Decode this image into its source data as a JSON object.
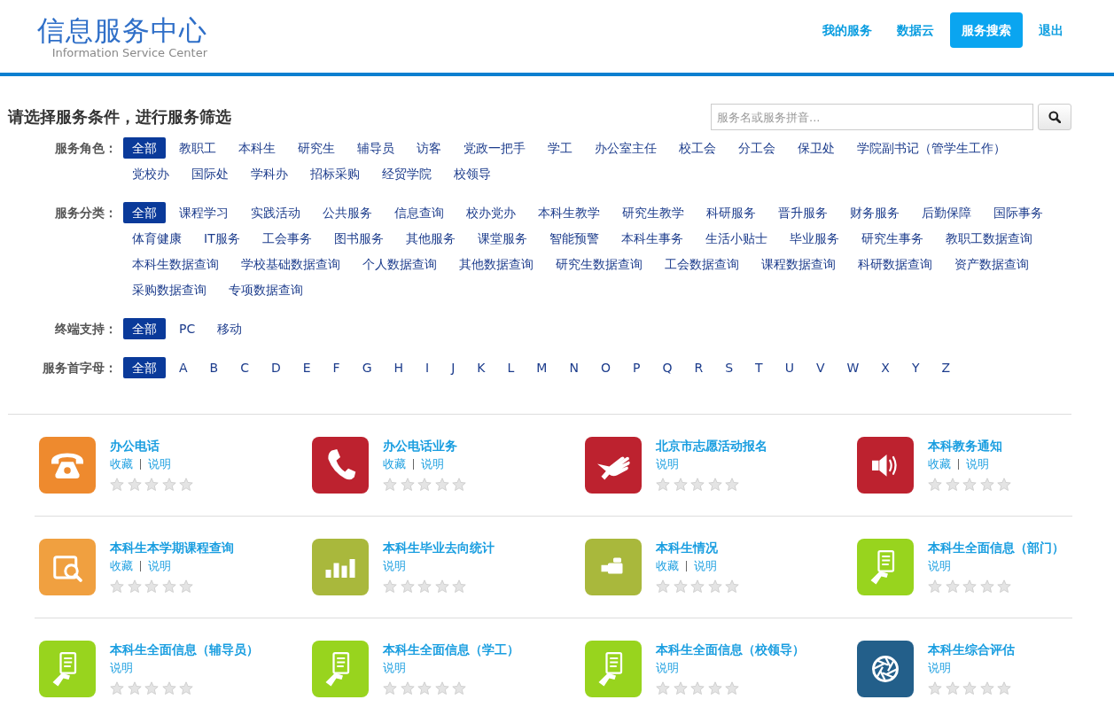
{
  "header": {
    "logo_title": "信息服务中心",
    "logo_subtitle": "Information Service Center",
    "nav": [
      {
        "label": "我的服务",
        "selected": false
      },
      {
        "label": "数据云",
        "selected": false
      },
      {
        "label": "服务搜索",
        "selected": true
      },
      {
        "label": "退出",
        "selected": false
      }
    ]
  },
  "filter": {
    "heading": "请选择服务条件，进行服务筛选",
    "search": {
      "placeholder": "服务名或服务拼音..."
    },
    "groups": [
      {
        "label": "服务角色：",
        "options": [
          {
            "label": "全部",
            "selected": true
          },
          {
            "label": "教职工",
            "selected": false
          },
          {
            "label": "本科生",
            "selected": false
          },
          {
            "label": "研究生",
            "selected": false
          },
          {
            "label": "辅导员",
            "selected": false
          },
          {
            "label": "访客",
            "selected": false
          },
          {
            "label": "党政一把手",
            "selected": false
          },
          {
            "label": "学工",
            "selected": false
          },
          {
            "label": "办公室主任",
            "selected": false
          },
          {
            "label": "校工会",
            "selected": false
          },
          {
            "label": "分工会",
            "selected": false
          },
          {
            "label": "保卫处",
            "selected": false
          },
          {
            "label": "学院副书记（管学生工作）",
            "selected": false
          },
          {
            "label": "党校办",
            "selected": false
          },
          {
            "label": "国际处",
            "selected": false
          },
          {
            "label": "学科办",
            "selected": false
          },
          {
            "label": "招标采购",
            "selected": false
          },
          {
            "label": "经贸学院",
            "selected": false
          },
          {
            "label": "校领导",
            "selected": false
          }
        ]
      },
      {
        "label": "服务分类：",
        "options": [
          {
            "label": "全部",
            "selected": true
          },
          {
            "label": "课程学习",
            "selected": false
          },
          {
            "label": "实践活动",
            "selected": false
          },
          {
            "label": "公共服务",
            "selected": false
          },
          {
            "label": "信息查询",
            "selected": false
          },
          {
            "label": "校办党办",
            "selected": false
          },
          {
            "label": "本科生教学",
            "selected": false
          },
          {
            "label": "研究生教学",
            "selected": false
          },
          {
            "label": "科研服务",
            "selected": false
          },
          {
            "label": "晋升服务",
            "selected": false
          },
          {
            "label": "财务服务",
            "selected": false
          },
          {
            "label": "后勤保障",
            "selected": false
          },
          {
            "label": "国际事务",
            "selected": false
          },
          {
            "label": "体育健康",
            "selected": false
          },
          {
            "label": "IT服务",
            "selected": false
          },
          {
            "label": "工会事务",
            "selected": false
          },
          {
            "label": "图书服务",
            "selected": false
          },
          {
            "label": "其他服务",
            "selected": false
          },
          {
            "label": "课堂服务",
            "selected": false
          },
          {
            "label": "智能预警",
            "selected": false
          },
          {
            "label": "本科生事务",
            "selected": false
          },
          {
            "label": "生活小贴士",
            "selected": false
          },
          {
            "label": "毕业服务",
            "selected": false
          },
          {
            "label": "研究生事务",
            "selected": false
          },
          {
            "label": "教职工数据查询",
            "selected": false
          },
          {
            "label": "本科生数据查询",
            "selected": false
          },
          {
            "label": "学校基础数据查询",
            "selected": false
          },
          {
            "label": "个人数据查询",
            "selected": false
          },
          {
            "label": "其他数据查询",
            "selected": false
          },
          {
            "label": "研究生数据查询",
            "selected": false
          },
          {
            "label": "工会数据查询",
            "selected": false
          },
          {
            "label": "课程数据查询",
            "selected": false
          },
          {
            "label": "科研数据查询",
            "selected": false
          },
          {
            "label": "资产数据查询",
            "selected": false
          },
          {
            "label": "采购数据查询",
            "selected": false
          },
          {
            "label": "专项数据查询",
            "selected": false
          }
        ]
      },
      {
        "label": "终端支持：",
        "options": [
          {
            "label": "全部",
            "selected": true
          },
          {
            "label": "PC",
            "selected": false
          },
          {
            "label": "移动",
            "selected": false
          }
        ]
      },
      {
        "label": "服务首字母：",
        "options": [
          {
            "label": "全部",
            "selected": true
          },
          {
            "label": "A",
            "selected": false
          },
          {
            "label": "B",
            "selected": false
          },
          {
            "label": "C",
            "selected": false
          },
          {
            "label": "D",
            "selected": false
          },
          {
            "label": "E",
            "selected": false
          },
          {
            "label": "F",
            "selected": false
          },
          {
            "label": "G",
            "selected": false
          },
          {
            "label": "H",
            "selected": false
          },
          {
            "label": "I",
            "selected": false
          },
          {
            "label": "J",
            "selected": false
          },
          {
            "label": "K",
            "selected": false
          },
          {
            "label": "L",
            "selected": false
          },
          {
            "label": "M",
            "selected": false
          },
          {
            "label": "N",
            "selected": false
          },
          {
            "label": "O",
            "selected": false
          },
          {
            "label": "P",
            "selected": false
          },
          {
            "label": "Q",
            "selected": false
          },
          {
            "label": "R",
            "selected": false
          },
          {
            "label": "S",
            "selected": false
          },
          {
            "label": "T",
            "selected": false
          },
          {
            "label": "U",
            "selected": false
          },
          {
            "label": "V",
            "selected": false
          },
          {
            "label": "W",
            "selected": false
          },
          {
            "label": "X",
            "selected": false
          },
          {
            "label": "Y",
            "selected": false
          },
          {
            "label": "Z",
            "selected": false
          }
        ]
      }
    ]
  },
  "services": [
    {
      "title": "办公电话",
      "kind": "telephone",
      "color": "#ee8a2e",
      "links": [
        "收藏",
        "说明"
      ],
      "stars": 0
    },
    {
      "title": "办公电话业务",
      "kind": "handset",
      "color": "#bd222f",
      "links": [
        "收藏",
        "说明"
      ],
      "stars": 0
    },
    {
      "title": "北京市志愿活动报名",
      "kind": "hand",
      "color": "#bd222f",
      "links": [
        "说明"
      ],
      "stars": 0
    },
    {
      "title": "本科教务通知",
      "kind": "speaker",
      "color": "#bd222f",
      "links": [
        "收藏",
        "说明"
      ],
      "stars": 0
    },
    {
      "title": "本科生本学期课程查询",
      "kind": "docsearch",
      "color": "#f0a040",
      "links": [
        "收藏",
        "说明"
      ],
      "stars": 0
    },
    {
      "title": "本科生毕业去向统计",
      "kind": "bars",
      "color": "#a9b83c",
      "links": [
        "说明"
      ],
      "stars": 0
    },
    {
      "title": "本科生情况",
      "kind": "camera",
      "color": "#a9b83c",
      "links": [
        "收藏",
        "说明"
      ],
      "stars": 0
    },
    {
      "title": "本科生全面信息（部门）",
      "kind": "handdoc",
      "color": "#98d41e",
      "links": [
        "说明"
      ],
      "stars": 0
    },
    {
      "title": "本科生全面信息（辅导员）",
      "kind": "handdoc",
      "color": "#98d41e",
      "links": [
        "说明"
      ],
      "stars": 0
    },
    {
      "title": "本科生全面信息（学工）",
      "kind": "handdoc",
      "color": "#98d41e",
      "links": [
        "说明"
      ],
      "stars": 0
    },
    {
      "title": "本科生全面信息（校领导）",
      "kind": "handdoc",
      "color": "#98d41e",
      "links": [
        "说明"
      ],
      "stars": 0
    },
    {
      "title": "本科生综合评估",
      "kind": "aperture",
      "color": "#235f8a",
      "links": [
        "说明"
      ],
      "stars": 0
    }
  ]
}
